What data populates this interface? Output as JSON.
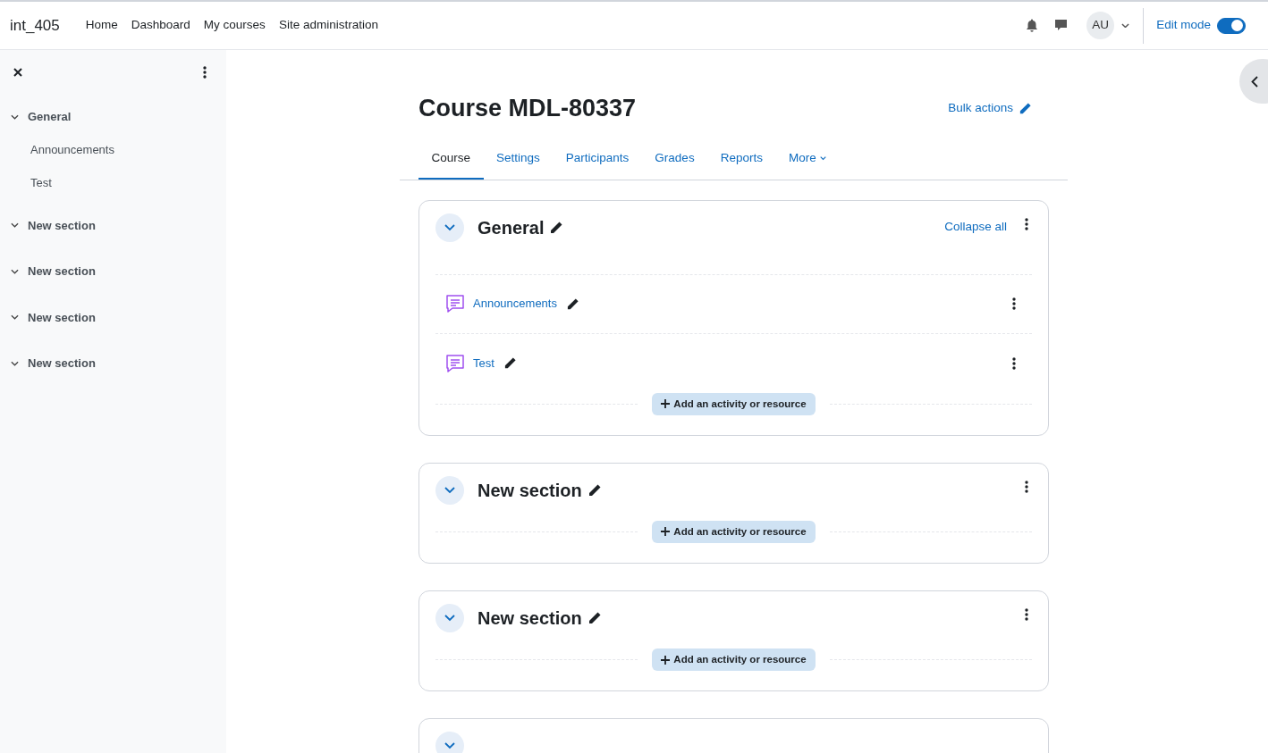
{
  "site_name": "int_405",
  "nav": [
    "Home",
    "Dashboard",
    "My courses",
    "Site administration"
  ],
  "user": {
    "initials": "AU"
  },
  "edit_mode": {
    "label": "Edit mode",
    "on": true
  },
  "course_index": {
    "sections": [
      {
        "title": "General",
        "expanded": true,
        "children": [
          {
            "title": "Announcements"
          },
          {
            "title": "Test"
          }
        ]
      },
      {
        "title": "New section",
        "expanded": true
      },
      {
        "title": "New section",
        "expanded": true
      },
      {
        "title": "New section",
        "expanded": true
      },
      {
        "title": "New section",
        "expanded": true
      }
    ]
  },
  "course": {
    "title": "Course MDL-80337",
    "bulk_actions": "Bulk actions",
    "tabs": [
      {
        "label": "Course",
        "selected": true,
        "dropdown": false
      },
      {
        "label": "Settings",
        "selected": false,
        "dropdown": false
      },
      {
        "label": "Participants",
        "selected": false,
        "dropdown": false
      },
      {
        "label": "Grades",
        "selected": false,
        "dropdown": false
      },
      {
        "label": "Reports",
        "selected": false,
        "dropdown": false
      },
      {
        "label": "More",
        "selected": false,
        "dropdown": true
      }
    ],
    "sections": [
      {
        "title": "General",
        "expanded": true,
        "collapse_all": "Collapse all",
        "activities": [
          {
            "title": "Announcements"
          },
          {
            "title": "Test"
          }
        ],
        "add_button": "Add an activity or resource"
      },
      {
        "title": "New section",
        "expanded": true,
        "add_button": "Add an activity or resource"
      },
      {
        "title": "New section",
        "expanded": true,
        "add_button": "Add an activity or resource"
      },
      {
        "expanded": true
      }
    ]
  }
}
